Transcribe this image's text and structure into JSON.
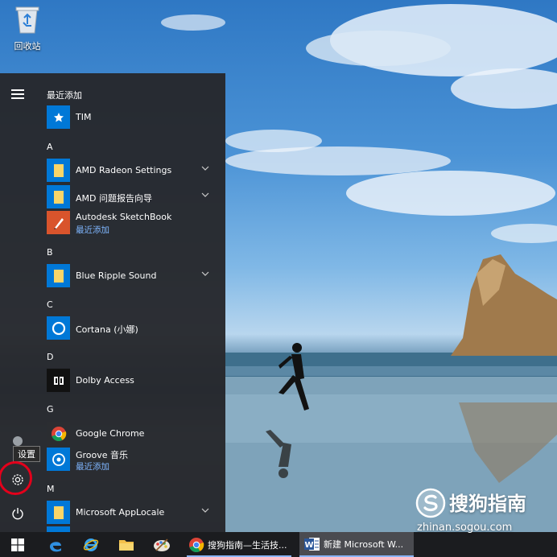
{
  "desktop": {
    "recycle_bin_label": "回收站"
  },
  "start_menu": {
    "sections": {
      "recent": "最近添加",
      "a": "A",
      "b": "B",
      "c": "C",
      "d": "D",
      "g": "G",
      "m": "M"
    },
    "apps": {
      "tim": {
        "name": "TIM",
        "icon": "star-icon"
      },
      "amd_radeon": {
        "name": "AMD Radeon Settings",
        "icon": "folder-icon"
      },
      "amd_report": {
        "name": "AMD 问题报告向导",
        "icon": "folder-icon"
      },
      "sketchbook": {
        "name": "Autodesk SketchBook",
        "sub": "最近添加",
        "icon": "sketchbook-icon"
      },
      "blue_ripple": {
        "name": "Blue Ripple Sound",
        "icon": "folder-icon"
      },
      "cortana": {
        "name": "Cortana (小娜)",
        "icon": "cortana-icon"
      },
      "dolby": {
        "name": "Dolby Access",
        "icon": "dolby-icon"
      },
      "chrome": {
        "name": "Google Chrome",
        "icon": "chrome-icon"
      },
      "groove": {
        "name": "Groove 音乐",
        "sub": "最近添加",
        "icon": "groove-icon"
      },
      "applocale": {
        "name": "Microsoft AppLocale",
        "icon": "folder-icon"
      }
    },
    "settings_tooltip": "设置"
  },
  "taskbar": {
    "chrome_task": "搜狗指南—生活技...",
    "word_task": "新建 Microsoft W..."
  },
  "watermark": {
    "title": "搜狗指南",
    "url": "zhinan.sogou.com"
  },
  "colors": {
    "accent_blue": "#0078d7",
    "folder_yellow": "#f8d568",
    "highlight_red": "#e3001b"
  }
}
